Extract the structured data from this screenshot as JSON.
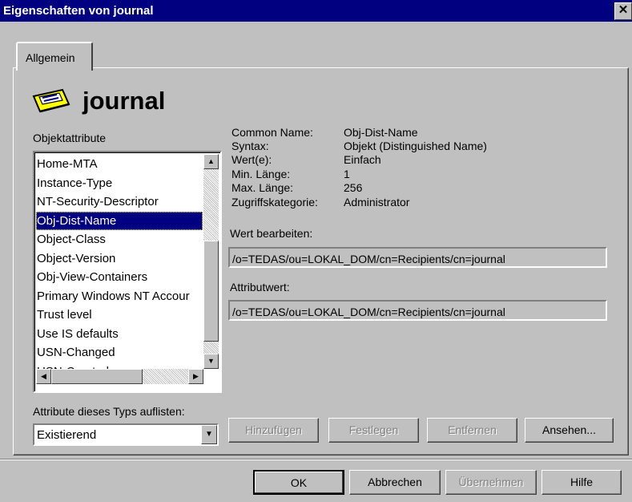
{
  "window": {
    "title": "Eigenschaften von journal",
    "close_glyph": "✕"
  },
  "tabs": [
    {
      "label": "Allgemein"
    }
  ],
  "object": {
    "name": "journal",
    "icon": "mailbox-recipient-icon"
  },
  "attributes": {
    "label": "Objektattribute",
    "items": [
      "Home-MTA",
      "Instance-Type",
      "NT-Security-Descriptor",
      "Obj-Dist-Name",
      "Object-Class",
      "Object-Version",
      "Obj-View-Containers",
      "Primary Windows NT Accour",
      "Trust level",
      "Use IS defaults",
      "USN-Changed",
      "USN-Created"
    ],
    "selected": "Obj-Dist-Name"
  },
  "details": {
    "common_name_label": "Common Name:",
    "common_name": "Obj-Dist-Name",
    "syntax_label": "Syntax:",
    "syntax": "Objekt (Distinguished Name)",
    "values_label": "Wert(e):",
    "values": "Einfach",
    "min_label": "Min. Länge:",
    "min": "1",
    "max_label": "Max. Länge:",
    "max": "256",
    "access_label": "Zugriffskategorie:",
    "access": "Administrator"
  },
  "edit_value": {
    "label": "Wert bearbeiten:",
    "value": "/o=TEDAS/ou=LOKAL_DOM/cn=Recipients/cn=journal"
  },
  "attribute_value": {
    "label": "Attributwert:",
    "value": "/o=TEDAS/ou=LOKAL_DOM/cn=Recipients/cn=journal"
  },
  "list_type": {
    "label": "Attribute dieses Typs auflisten:",
    "selected": "Existierend"
  },
  "value_buttons": {
    "add": "Hinzufügen",
    "set": "Festlegen",
    "remove": "Entfernen",
    "view": "Ansehen..."
  },
  "dialog_buttons": {
    "ok": "OK",
    "cancel": "Abbrechen",
    "apply": "Übernehmen",
    "help": "Hilfe"
  },
  "colors": {
    "titlebar": "#000080",
    "face": "#c0c0c0",
    "selection": "#000080"
  }
}
